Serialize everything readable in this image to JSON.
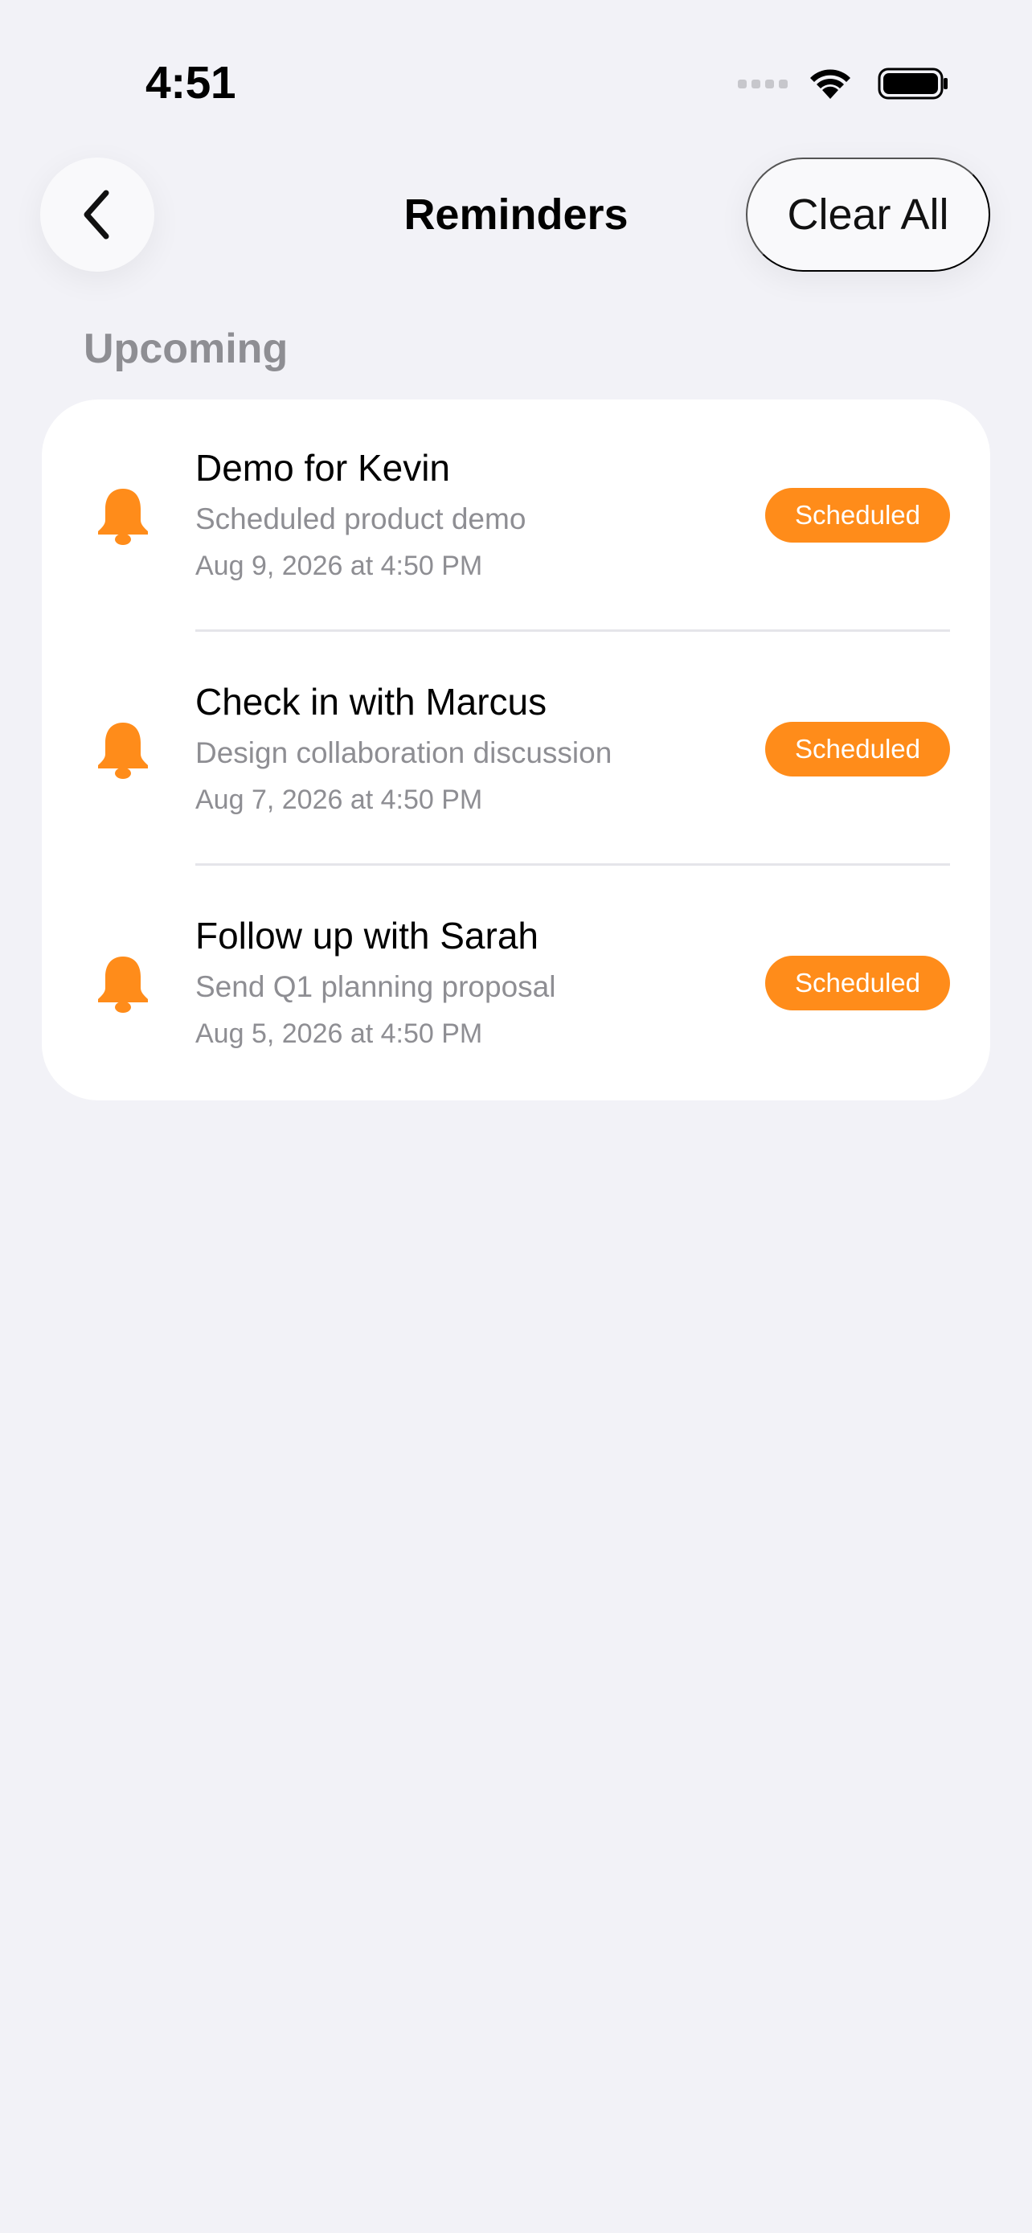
{
  "status_bar": {
    "time": "4:51"
  },
  "nav": {
    "title": "Reminders",
    "clear_label": "Clear All"
  },
  "section": {
    "header": "Upcoming"
  },
  "reminders": [
    {
      "title": "Demo for Kevin",
      "subtitle": "Scheduled product demo",
      "date": "Aug 9, 2026 at 4:50 PM",
      "status": "Scheduled"
    },
    {
      "title": "Check in with Marcus",
      "subtitle": "Design collaboration discussion",
      "date": "Aug 7, 2026 at 4:50 PM",
      "status": "Scheduled"
    },
    {
      "title": "Follow up with Sarah",
      "subtitle": "Send Q1 planning proposal",
      "date": "Aug 5, 2026 at 4:50 PM",
      "status": "Scheduled"
    }
  ],
  "icons": {
    "back": "chevron-left-icon",
    "row": "bell-icon"
  },
  "colors": {
    "accent": "#ff8c1a",
    "background": "#f2f2f7",
    "secondary_text": "#8e8e93"
  }
}
